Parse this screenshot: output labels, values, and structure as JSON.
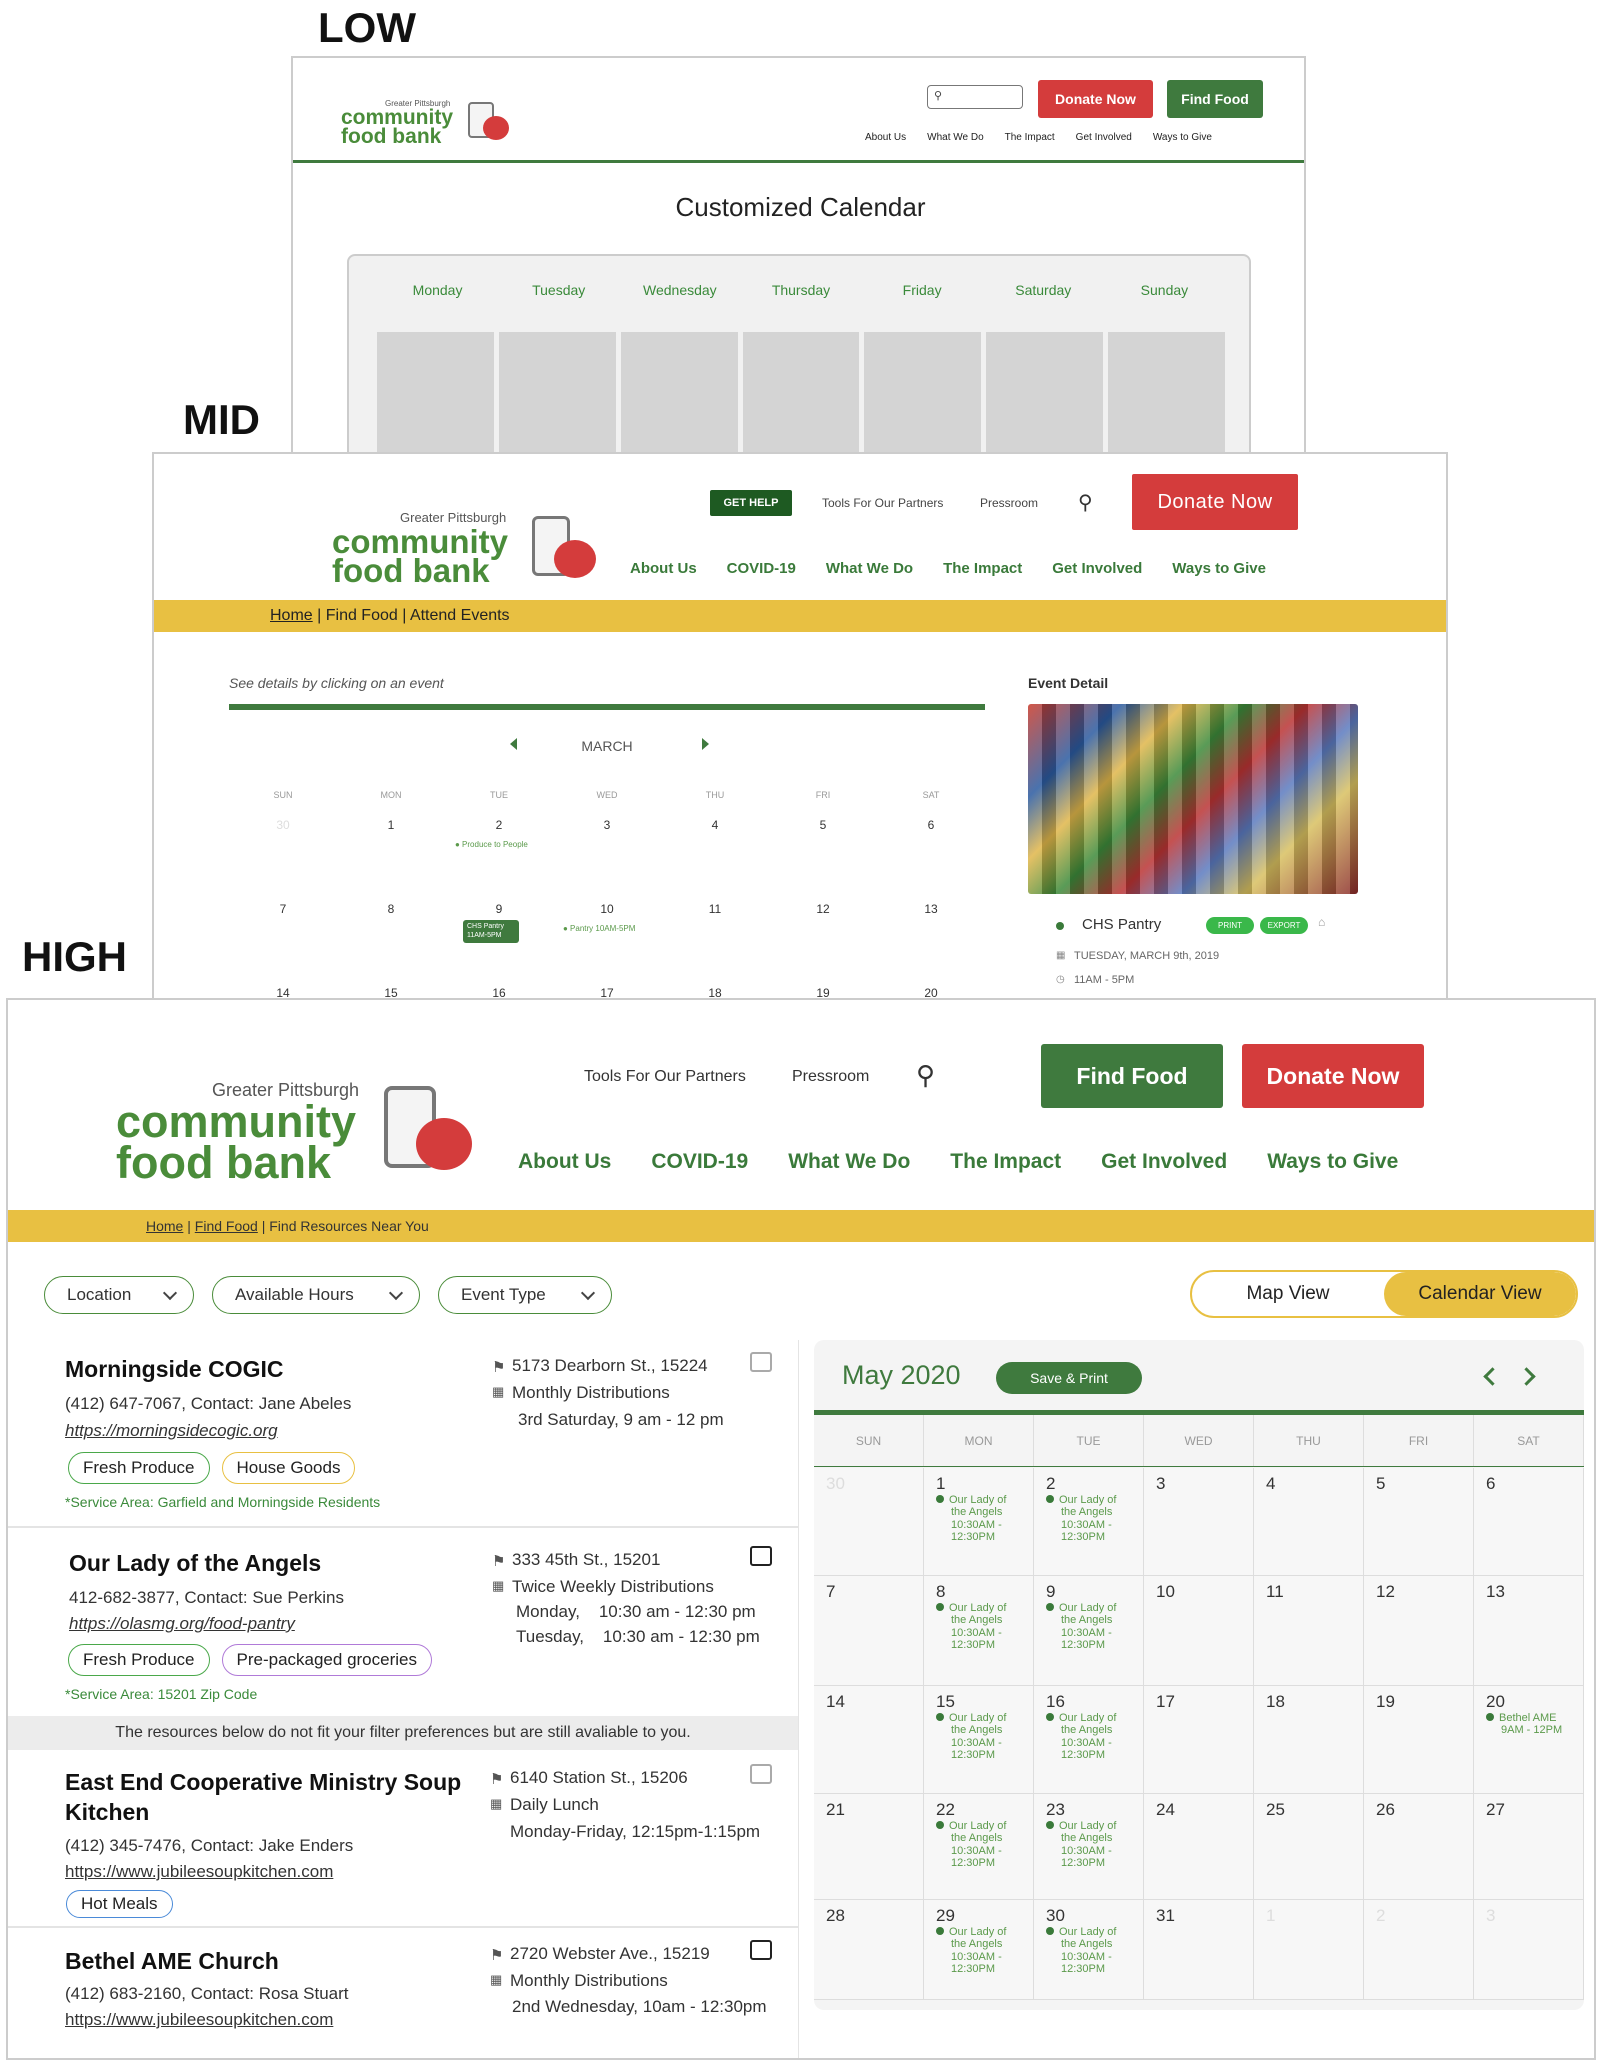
{
  "labels": {
    "low": "LOW",
    "mid": "MID",
    "high": "HIGH"
  },
  "colors": {
    "brand_green": "#3f7a3e",
    "accent_red": "#d43c3c",
    "breadcrumb_yellow": "#e8c042",
    "event_green": "#5b9a4b"
  },
  "logo": {
    "greater": "Greater Pittsburgh",
    "line1": "community",
    "line2": "food bank"
  },
  "low": {
    "buttons": {
      "donate": "Donate Now",
      "find": "Find Food"
    },
    "nav": [
      "About Us",
      "What We Do",
      "The Impact",
      "Get Involved",
      "Ways to Give"
    ],
    "title": "Customized Calendar",
    "days": [
      "Monday",
      "Tuesday",
      "Wednesday",
      "Thursday",
      "Friday",
      "Saturday",
      "Sunday"
    ]
  },
  "mid": {
    "get_help": "GET HELP",
    "utility": [
      "Tools For Our Partners",
      "Pressroom"
    ],
    "donate": "Donate Now",
    "nav": [
      "About Us",
      "COVID-19",
      "What We Do",
      "The Impact",
      "Get Involved",
      "Ways to Give"
    ],
    "breadcrumb": {
      "home": "Home",
      "rest": " | Find Food | Attend Events"
    },
    "hint": "See details by clicking on an event",
    "month": "MARCH",
    "weekdays": [
      "SUN",
      "MON",
      "TUE",
      "WED",
      "THU",
      "FRI",
      "SAT"
    ],
    "weeks": [
      [
        "30",
        "1",
        "2",
        "3",
        "4",
        "5",
        "6"
      ],
      [
        "7",
        "8",
        "9",
        "10",
        "11",
        "12",
        "13"
      ],
      [
        "14",
        "15",
        "16",
        "17",
        "18",
        "19",
        "20"
      ]
    ],
    "events": {
      "produce": "Produce to People",
      "chs_line1": "CHS Pantry",
      "chs_line2": "11AM-5PM",
      "pantry": "Pantry 10AM-5PM"
    },
    "detail": {
      "heading": "Event Detail",
      "name": "CHS Pantry",
      "print": "PRINT",
      "export": "EXPORT",
      "date": "TUESDAY, MARCH 9th, 2019",
      "time": "11AM - 5PM"
    }
  },
  "high": {
    "utility": [
      "Tools For Our Partners",
      "Pressroom"
    ],
    "find": "Find Food",
    "donate": "Donate Now",
    "nav": [
      "About Us",
      "COVID-19",
      "What We Do",
      "The Impact",
      "Get Involved",
      "Ways to Give"
    ],
    "breadcrumb": {
      "home": "Home",
      "find": "Find Food",
      "rest": " | Find Resources Near You"
    },
    "filters": [
      "Location",
      "Available Hours",
      "Event Type"
    ],
    "view_toggle": {
      "map": "Map View",
      "calendar": "Calendar View",
      "active": "calendar"
    },
    "cards": [
      {
        "title": "Morningside COGIC",
        "phone": "(412) 647-7067, Contact: Jane Abeles",
        "url": "https://morningsidecogic.org",
        "tags": [
          "Fresh Produce",
          "House Goods"
        ],
        "service": "*Service Area: Garfield and Morningside Residents",
        "address": "5173 Dearborn St., 15224",
        "schedule": "Monthly Distributions",
        "hours": [
          "3rd Saturday, 9 am - 12 pm"
        ]
      },
      {
        "title": "Our Lady of the Angels",
        "phone": "412-682-3877, Contact: Sue Perkins",
        "url": "https://olasmg.org/food-pantry",
        "tags": [
          "Fresh Produce",
          "Pre-packaged groceries"
        ],
        "service": "*Service Area: 15201 Zip Code",
        "address": "333 45th St., 15201",
        "schedule": "Twice Weekly Distributions",
        "hours": [
          "Monday,    10:30 am - 12:30 pm",
          "Tuesday,    10:30 am - 12:30 pm"
        ]
      },
      {
        "title": "East End Cooperative Ministry Soup Kitchen",
        "phone": "(412) 345-7476, Contact: Jake Enders",
        "url": "https://www.jubileesoupkitchen.com",
        "tags": [
          "Hot Meals"
        ],
        "address": "6140 Station St., 15206",
        "schedule": "Daily Lunch",
        "hours": [
          "Monday-Friday, 12:15pm-1:15pm"
        ]
      },
      {
        "title": "Bethel AME Church",
        "phone": "(412) 683-2160, Contact: Rosa Stuart",
        "url": "https://www.jubileesoupkitchen.com",
        "address": "2720 Webster Ave., 15219",
        "schedule": "Monthly Distributions",
        "hours": [
          "2nd Wednesday, 10am - 12:30pm"
        ]
      }
    ],
    "divider_note": "The resources below do not fit your filter preferences but are still avaliable to you.",
    "calendar": {
      "month": "May 2020",
      "save_print": "Save & Print",
      "weekdays": [
        "SUN",
        "MON",
        "TUE",
        "WED",
        "THU",
        "FRI",
        "SAT"
      ],
      "weeks": [
        [
          {
            "d": "30",
            "m": 1
          },
          {
            "d": "1",
            "e": "ola"
          },
          {
            "d": "2",
            "e": "ola"
          },
          {
            "d": "3"
          },
          {
            "d": "4"
          },
          {
            "d": "5"
          },
          {
            "d": "6"
          }
        ],
        [
          {
            "d": "7"
          },
          {
            "d": "8",
            "e": "ola"
          },
          {
            "d": "9",
            "e": "ola"
          },
          {
            "d": "10"
          },
          {
            "d": "11"
          },
          {
            "d": "12"
          },
          {
            "d": "13"
          }
        ],
        [
          {
            "d": "14"
          },
          {
            "d": "15",
            "e": "ola"
          },
          {
            "d": "16",
            "e": "ola"
          },
          {
            "d": "17"
          },
          {
            "d": "18"
          },
          {
            "d": "19"
          },
          {
            "d": "20",
            "e": "bethel"
          }
        ],
        [
          {
            "d": "21"
          },
          {
            "d": "22",
            "e": "ola"
          },
          {
            "d": "23",
            "e": "ola"
          },
          {
            "d": "24"
          },
          {
            "d": "25"
          },
          {
            "d": "26"
          },
          {
            "d": "27"
          }
        ],
        [
          {
            "d": "28"
          },
          {
            "d": "29",
            "e": "ola"
          },
          {
            "d": "30",
            "e": "ola"
          },
          {
            "d": "31"
          },
          {
            "d": "1",
            "m": 1
          },
          {
            "d": "2",
            "m": 1
          },
          {
            "d": "3",
            "m": 1
          }
        ]
      ],
      "event_text": {
        "ola": [
          "Our Lady of",
          "the Angels",
          "10:30AM -",
          "12:30PM"
        ],
        "bethel": [
          "Bethel AME",
          "9AM - 12PM"
        ]
      }
    }
  }
}
